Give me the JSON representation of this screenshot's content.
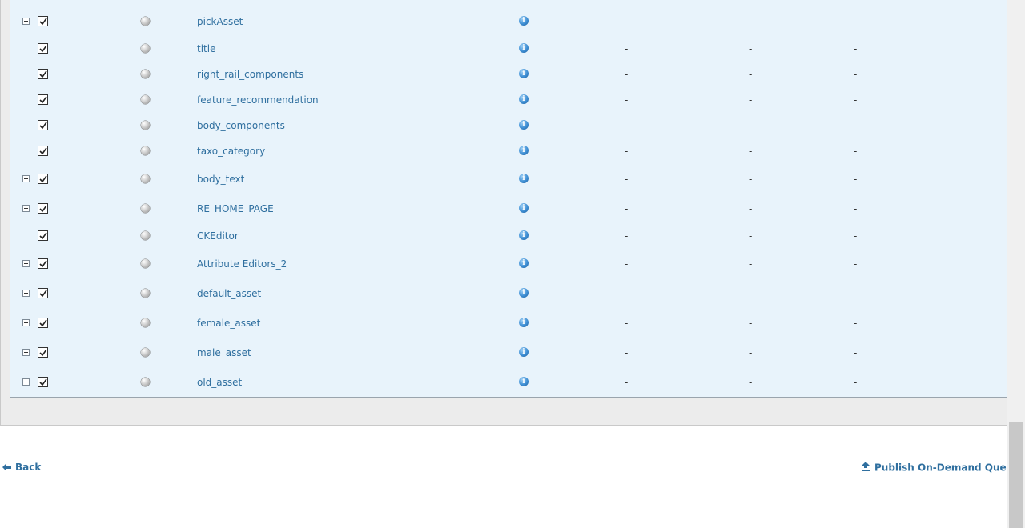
{
  "rows": [
    {
      "name": "pickAsset",
      "expandable": true,
      "col1": "-",
      "col2": "-",
      "col3": "-"
    },
    {
      "name": "title",
      "expandable": false,
      "col1": "-",
      "col2": "-",
      "col3": "-"
    },
    {
      "name": "right_rail_components",
      "expandable": false,
      "col1": "-",
      "col2": "-",
      "col3": "-"
    },
    {
      "name": "feature_recommendation",
      "expandable": false,
      "col1": "-",
      "col2": "-",
      "col3": "-"
    },
    {
      "name": "body_components",
      "expandable": false,
      "col1": "-",
      "col2": "-",
      "col3": "-"
    },
    {
      "name": "taxo_category",
      "expandable": false,
      "col1": "-",
      "col2": "-",
      "col3": "-"
    },
    {
      "name": "body_text",
      "expandable": true,
      "col1": "-",
      "col2": "-",
      "col3": "-"
    },
    {
      "name": "RE_HOME_PAGE",
      "expandable": true,
      "col1": "-",
      "col2": "-",
      "col3": "-"
    },
    {
      "name": "CKEditor",
      "expandable": false,
      "col1": "-",
      "col2": "-",
      "col3": "-"
    },
    {
      "name": "Attribute Editors_2",
      "expandable": true,
      "col1": "-",
      "col2": "-",
      "col3": "-"
    },
    {
      "name": "default_asset",
      "expandable": true,
      "col1": "-",
      "col2": "-",
      "col3": "-"
    },
    {
      "name": "female_asset",
      "expandable": true,
      "col1": "-",
      "col2": "-",
      "col3": "-"
    },
    {
      "name": "male_asset",
      "expandable": true,
      "col1": "-",
      "col2": "-",
      "col3": "-"
    },
    {
      "name": "old_asset",
      "expandable": true,
      "col1": "-",
      "col2": "-",
      "col3": "-"
    }
  ],
  "footer": {
    "back_label": "Back",
    "publish_label": "Publish On-Demand Queue"
  },
  "colors": {
    "table_bg": "#e8f3fb",
    "link": "#2f6f9f",
    "panel_bg": "#ececec"
  },
  "icons": {
    "expander": "plus-box-icon",
    "check": "checkbox-checked-icon",
    "status": "gray-status-dot-icon",
    "info": "info-icon",
    "back": "back-arrow-icon",
    "publish": "upload-icon"
  }
}
